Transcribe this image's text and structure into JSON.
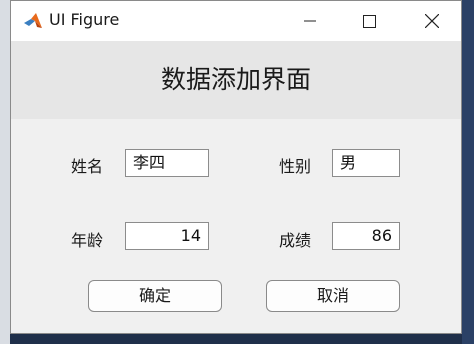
{
  "window": {
    "title": "UI Figure",
    "icon": "matlab-logo-icon",
    "controls": [
      "minimize-icon",
      "maximize-icon",
      "close-icon"
    ]
  },
  "header": {
    "title": "数据添加界面"
  },
  "form": {
    "name_label": "姓名",
    "name_value": "李四",
    "gender_label": "性别",
    "gender_value": "男",
    "age_label": "年龄",
    "age_value": "14",
    "score_label": "成绩",
    "score_value": "86"
  },
  "buttons": {
    "confirm_label": "确定",
    "cancel_label": "取消"
  }
}
